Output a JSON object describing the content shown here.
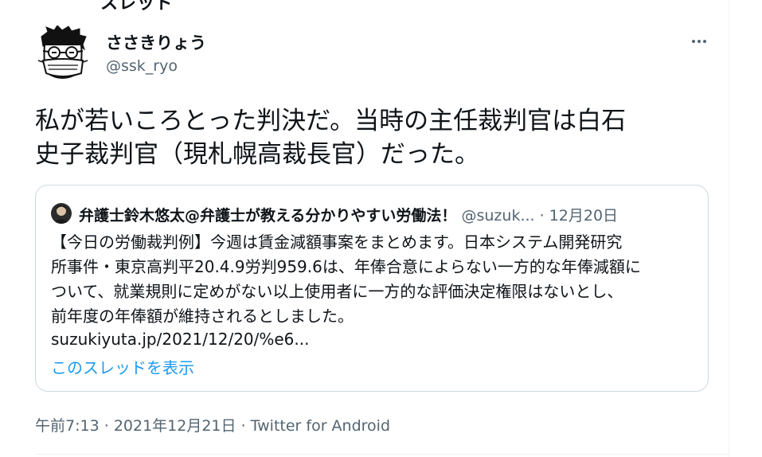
{
  "top_cut_text": "スレッド",
  "author": {
    "display_name": "ささきりょう",
    "handle": "@ssk_ryo",
    "avatar_icon": "cartoon-face-with-glasses-and-mask"
  },
  "more_icon": "more-horizontal-icon",
  "tweet_text": "私が若いころとった判決だ。当時の主任裁判官は白石\n史子裁判官（現札幌高裁長官）だった。",
  "quoted_tweet": {
    "author_name": "弁護士鈴木悠太@弁護士が教える分かりやすい労働法！",
    "author_handle": "@suzuk...",
    "date": "12月20日",
    "separator": "·",
    "text": "【今日の労働裁判例】今週は賃金減額事案をまとめます。日本システム開発研究\n所事件・東京高判平20.4.9労判959.6は、年俸合意によらない一方的な年俸減額に\nついて、就業規則に定めがない以上使用者に一方的な評価決定権限はないとし、\n前年度の年俸額が維持されるとしました。",
    "link": "suzukiyuta.jp/2021/12/20/%e6...",
    "show_thread": "このスレッドを表示"
  },
  "meta": {
    "time": "午前7:13",
    "date": "2021年12月21日",
    "separator": "·",
    "app": "Twitter for Android"
  },
  "colors": {
    "text_primary": "#0f1419",
    "text_secondary": "#536471",
    "link_blue": "#1d9bf0",
    "border": "#cfd9de"
  }
}
